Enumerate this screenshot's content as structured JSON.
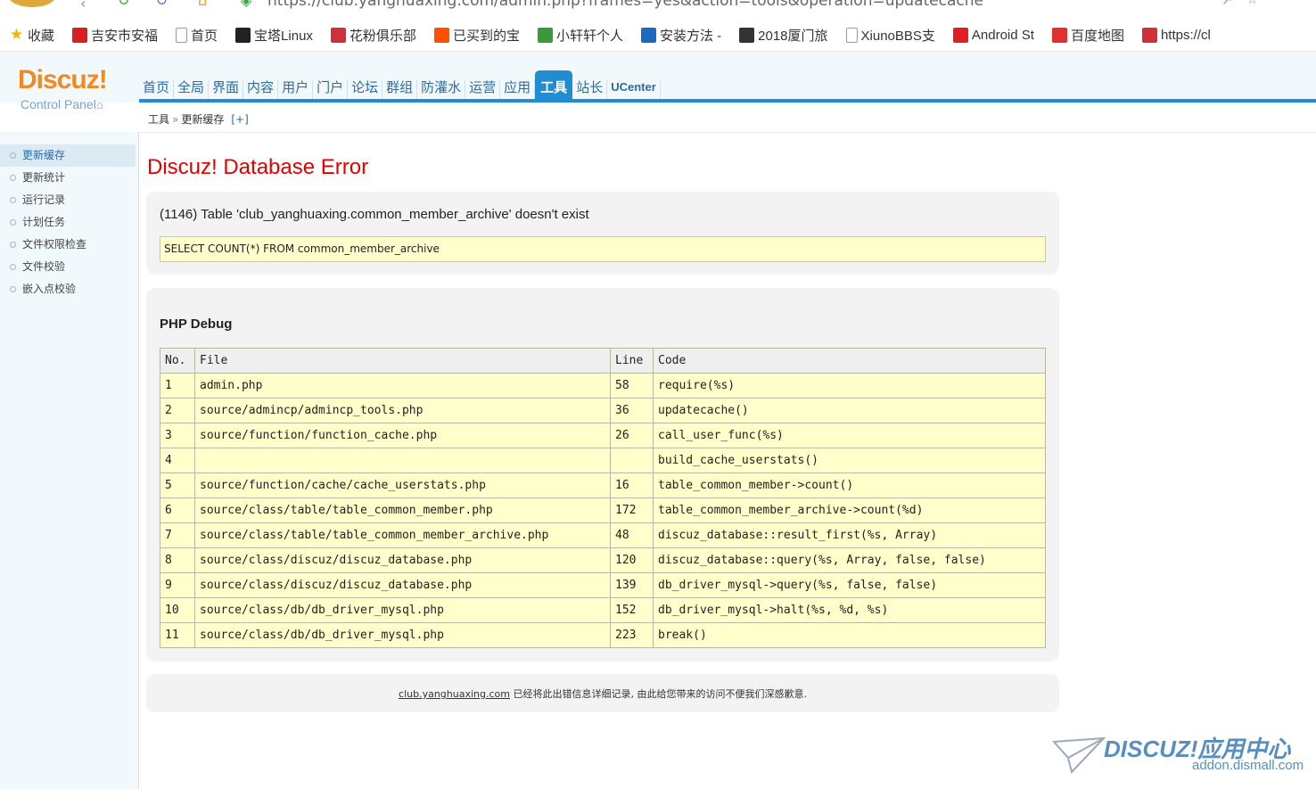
{
  "browser": {
    "url": "https://club.yanghuaxing.com/admin.php?frames=yes&action=tools&operation=updatecache",
    "bookmarks": [
      {
        "label": "收藏",
        "icon": "star-icon",
        "color": "#f5b400"
      },
      {
        "label": "吉安市安福",
        "icon": "site-icon",
        "color": "#d82020"
      },
      {
        "label": "首页",
        "icon": "page-icon",
        "color": "#999999"
      },
      {
        "label": "宝塔Linux",
        "icon": "bt-icon",
        "color": "#222222"
      },
      {
        "label": "花粉俱乐部",
        "icon": "huawei-icon",
        "color": "#d0303a"
      },
      {
        "label": "已买到的宝",
        "icon": "taobao-icon",
        "color": "#ff5000"
      },
      {
        "label": "小轩轩个人",
        "icon": "leaf-icon",
        "color": "#3a9a3a"
      },
      {
        "label": "安装方法 -",
        "icon": "shield-icon",
        "color": "#1a6ac0"
      },
      {
        "label": "2018厦门旅",
        "icon": "e-icon",
        "color": "#333333"
      },
      {
        "label": "XiunoBBS支",
        "icon": "page-icon",
        "color": "#999999"
      },
      {
        "label": "Android St",
        "icon": "android-icon",
        "color": "#e02020"
      },
      {
        "label": "百度地图",
        "icon": "map-pin-icon",
        "color": "#e03030"
      },
      {
        "label": "https://cl",
        "icon": "huawei-icon",
        "color": "#d0303a"
      }
    ]
  },
  "header": {
    "logo_title": "Discuz!",
    "logo_sub": "Control Panel",
    "nav": [
      "首页",
      "全局",
      "界面",
      "内容",
      "用户",
      "门户",
      "论坛",
      "群组",
      "防灌水",
      "运营",
      "应用",
      "工具",
      "站长",
      "UCenter"
    ],
    "active_nav": "工具"
  },
  "breadcrumb": {
    "section": "工具",
    "sep": "»",
    "page": "更新缓存",
    "plus": "[+]"
  },
  "sidebar": {
    "items": [
      "更新缓存",
      "更新统计",
      "运行记录",
      "计划任务",
      "文件权限检查",
      "文件校验",
      "嵌入点校验"
    ],
    "active": "更新缓存"
  },
  "error": {
    "title": "Discuz! Database Error",
    "message": "(1146) Table 'club_yanghuaxing.common_member_archive' doesn't exist",
    "sql": "SELECT COUNT(*) FROM common_member_archive"
  },
  "debug": {
    "title": "PHP Debug",
    "headers": [
      "No.",
      "File",
      "Line",
      "Code"
    ],
    "rows": [
      [
        "1",
        "admin.php",
        "58",
        "require(%s)"
      ],
      [
        "2",
        "source/admincp/admincp_tools.php",
        "36",
        "updatecache()"
      ],
      [
        "3",
        "source/function/function_cache.php",
        "26",
        "call_user_func(%s)"
      ],
      [
        "4",
        "",
        "",
        "build_cache_userstats()"
      ],
      [
        "5",
        "source/function/cache/cache_userstats.php",
        "16",
        "table_common_member->count()"
      ],
      [
        "6",
        "source/class/table/table_common_member.php",
        "172",
        "table_common_member_archive->count(%d)"
      ],
      [
        "7",
        "source/class/table/table_common_member_archive.php",
        "48",
        "discuz_database::result_first(%s, Array)"
      ],
      [
        "8",
        "source/class/discuz/discuz_database.php",
        "120",
        "discuz_database::query(%s, Array, false, false)"
      ],
      [
        "9",
        "source/class/discuz/discuz_database.php",
        "139",
        "db_driver_mysql->query(%s, false, false)"
      ],
      [
        "10",
        "source/class/db/db_driver_mysql.php",
        "152",
        "db_driver_mysql->halt(%s, %d, %s)"
      ],
      [
        "11",
        "source/class/db/db_driver_mysql.php",
        "223",
        "break()"
      ]
    ]
  },
  "footer": {
    "link": "club.yanghuaxing.com",
    "text": " 已经将此出错信息详细记录, 由此给您带来的访问不便我们深感歉意."
  },
  "watermark": {
    "title": "DISCUZ!应用中心",
    "sub": "addon.dismall.com"
  },
  "colors": {
    "accent": "#1f8dd0",
    "error": "#e50000",
    "logo": "#f08a24",
    "highlight": "#ffffcc"
  }
}
